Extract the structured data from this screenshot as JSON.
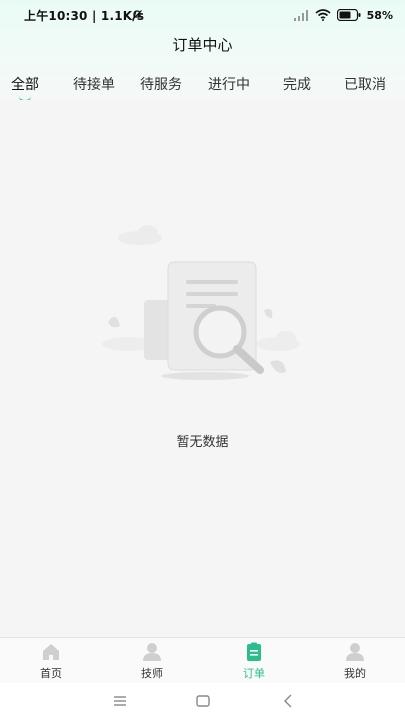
{
  "status_bar": {
    "time_speed": "上午10:30 | 1.1K/s",
    "battery": "58%"
  },
  "header": {
    "title": "订单中心"
  },
  "tabs": [
    {
      "label": "全部",
      "active": true
    },
    {
      "label": "待接单",
      "active": false
    },
    {
      "label": "待服务",
      "active": false
    },
    {
      "label": "进行中",
      "active": false
    },
    {
      "label": "完成",
      "active": false
    },
    {
      "label": "已取消",
      "active": false
    }
  ],
  "empty_state": {
    "text": "暂无数据",
    "icon": "empty-document-magnifier"
  },
  "tabbar": [
    {
      "label": "首页",
      "icon": "home-icon",
      "active": false
    },
    {
      "label": "技师",
      "icon": "person-icon",
      "active": false
    },
    {
      "label": "订单",
      "icon": "order-icon",
      "active": true
    },
    {
      "label": "我的",
      "icon": "user-icon",
      "active": false
    }
  ],
  "colors": {
    "accent": "#2bbd8e",
    "background": "#f5f5f5"
  }
}
